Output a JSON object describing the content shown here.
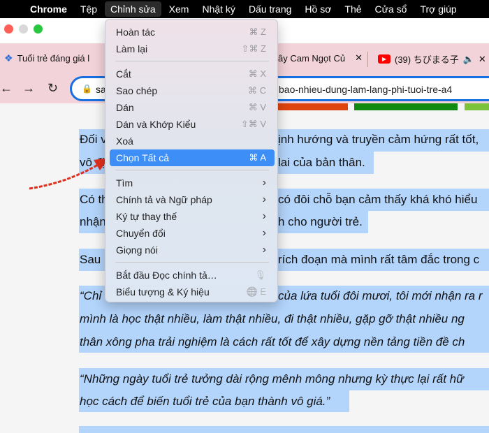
{
  "menubar": {
    "apple": "",
    "app": "Chrome",
    "items": [
      "Tệp",
      "Chỉnh sửa",
      "Xem",
      "Nhật ký",
      "Dấu trang",
      "Hồ sơ",
      "Thẻ",
      "Cửa sổ",
      "Trợ giúp"
    ],
    "active": "Chỉnh sửa"
  },
  "tabs": [
    {
      "title": "Tuổi trẻ đáng giá l",
      "icon": "site-icon"
    },
    {
      "title": "ây Cam Ngọt Củ",
      "icon": "close-icon"
    },
    {
      "title": "(39) ちびまる子",
      "icon": "youtube-icon"
    }
  ],
  "toolbar": {
    "address_left": "sa",
    "address_right": "bao-nhieu-dung-lam-lang-phi-tuoi-tre-a4"
  },
  "colors": {
    "accent": "#3d8ef7",
    "selection": "#b3d4fb",
    "tab_bg": "#f3d3da",
    "arrow": "#e0301e"
  },
  "article": {
    "lines": [
      {
        "left": "Đối v",
        "right": "ịnh hướng và truyền cảm hứng rất tốt,"
      },
      {
        "left": "vô đị",
        "right": "lai của bản thân."
      },
      {
        "left": "Có th",
        "right": "có đôi chỗ bạn cảm thấy khá khó hiểu"
      },
      {
        "left": "nhận",
        "right": "h cho người trẻ."
      },
      {
        "left": "Sau",
        "right": "rích đoạn mà mình rất tâm đắc trong c"
      },
      {
        "left": "“Chỉ",
        "right": "của lứa tuổi đôi mươi, tôi mới nhận ra r"
      },
      {
        "left": "mình là học thật nhiều, làm thật nhiều, đi thật nhiều, gặp gỡ thật nhiều ng",
        "right": ""
      },
      {
        "left": "thân xông pha trải nghiệm là cách rất tốt để xây dựng nền tảng tiền đề ch",
        "right": ""
      },
      {
        "left": "“Những ngày tuổi trẻ tưởng dài rộng mênh mông nhưng kỳ thực lại rất hữ",
        "right": ""
      },
      {
        "left": "học cách để biến tuổi trẻ của bạn thành vô giá.”",
        "right": ""
      }
    ]
  },
  "edit_menu": {
    "items": [
      {
        "label": "Hoàn tác",
        "shortcut": "⌘ Z"
      },
      {
        "label": "Làm lại",
        "shortcut": "⇧⌘ Z"
      },
      {
        "label": "Cắt",
        "shortcut": "⌘ X"
      },
      {
        "label": "Sao chép",
        "shortcut": "⌘ C"
      },
      {
        "label": "Dán",
        "shortcut": "⌘ V"
      },
      {
        "label": "Dán và Khớp Kiểu",
        "shortcut": "⇧⌘ V"
      },
      {
        "label": "Xoá",
        "shortcut": ""
      },
      {
        "label": "Chọn Tất cả",
        "shortcut": "⌘ A",
        "selected": true
      },
      {
        "label": "Tìm",
        "shortcut": "›"
      },
      {
        "label": "Chính tả và Ngữ pháp",
        "shortcut": "›"
      },
      {
        "label": "Ký tự thay thế",
        "shortcut": "›"
      },
      {
        "label": "Chuyển đổi",
        "shortcut": "›"
      },
      {
        "label": "Giọng nói",
        "shortcut": "›"
      },
      {
        "label": "Bắt đầu Đọc chính tả…",
        "shortcut": "🎙"
      },
      {
        "label": "Biểu tượng & Ký hiệu",
        "shortcut": "🌐 E"
      }
    ]
  }
}
